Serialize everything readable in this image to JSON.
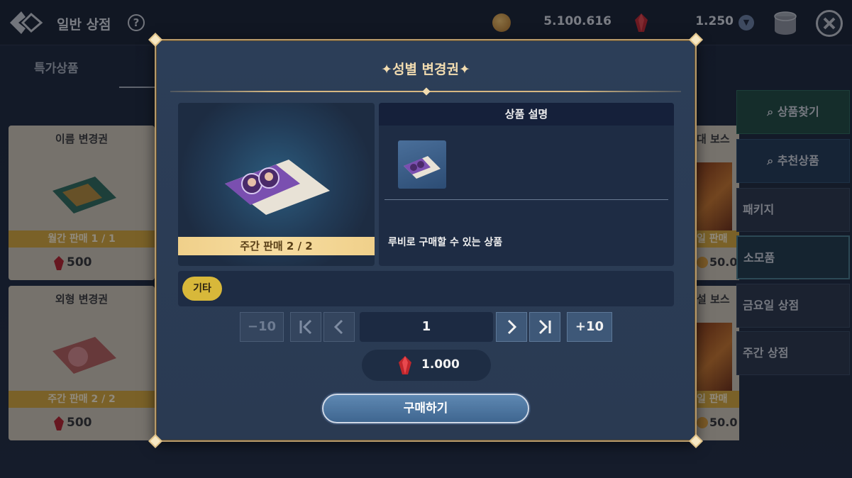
{
  "header": {
    "title": "일반 상점",
    "help_label": "?",
    "gold": "5.100.616",
    "ruby": "1.250"
  },
  "tabs": {
    "special": "특가상품"
  },
  "background_cards": [
    {
      "title": "이름 변경권",
      "limit": "월간 판매 1 / 1",
      "price": "500"
    },
    {
      "title": "외형 변경권",
      "limit": "주간 판매 2 / 2",
      "price": "500"
    }
  ],
  "right_cards": [
    {
      "title": "대 보스",
      "limit": "일 판매",
      "price": "50.0"
    },
    {
      "title": "설 보스",
      "limit": "일 판매",
      "price": "50.0"
    }
  ],
  "sidebar": {
    "items": [
      {
        "label": "상품찾기"
      },
      {
        "label": "추천상품"
      },
      {
        "label": "패키지"
      },
      {
        "label": "소모품"
      },
      {
        "label": "금요일 상점"
      },
      {
        "label": "주간 상점"
      }
    ]
  },
  "modal": {
    "title": "성별 변경권",
    "item_limit": "주간 판매 2 / 2",
    "desc_header": "상품 설명",
    "desc_text": "루비로 구매할 수 있는 상품",
    "tag": "기타",
    "minus10": "−10",
    "plus10": "+10",
    "quantity": "1",
    "price": "1.000",
    "buy_label": "구매하기"
  },
  "colors": {
    "accent_gold": "#d6b882",
    "buy_button": "#4f78a2",
    "limit_band": "#f0d08a"
  }
}
